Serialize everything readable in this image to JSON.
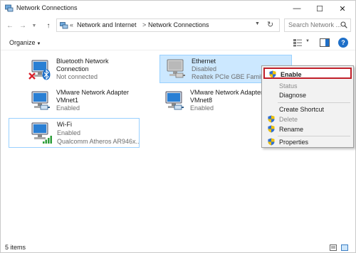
{
  "window": {
    "title": "Network Connections",
    "minimize_icon": "minimize-icon",
    "maximize_icon": "maximize-icon",
    "close_icon": "close-icon"
  },
  "address_bar": {
    "prefix": "«",
    "breadcrumbs": [
      "Network and Internet",
      "Network Connections"
    ],
    "separator": ">",
    "search_placeholder": "Search Network ..."
  },
  "command_bar": {
    "organize_label": "Organize"
  },
  "items": [
    {
      "name": "Bluetooth Network Connection",
      "name_line1": "Bluetooth Network",
      "name_line2": "Connection",
      "status": "Not connected",
      "device": "",
      "state": "disconnected"
    },
    {
      "name": "Ethernet",
      "status": "Disabled",
      "device": "Realtek PCIe GBE Family C...",
      "state": "disabled"
    },
    {
      "name_line1": "VMware Network Adapter",
      "name_line2": "VMnet1",
      "status": "Enabled",
      "device": "",
      "state": "enabled"
    },
    {
      "name_line1": "VMware Network Adapter",
      "name_line2": "VMnet8",
      "status": "Enabled",
      "device": "",
      "state": "enabled"
    },
    {
      "name": "Wi-Fi",
      "status": "Enabled",
      "device": "Qualcomm Atheros AR946x...",
      "state": "wifi"
    }
  ],
  "context_menu": {
    "items": [
      {
        "label": "Enable",
        "shield": true,
        "disabled": false,
        "default": true
      },
      {
        "label": "Status",
        "shield": false,
        "disabled": true
      },
      {
        "label": "Diagnose",
        "shield": false,
        "disabled": false
      },
      {
        "label": "Create Shortcut",
        "shield": false,
        "disabled": false
      },
      {
        "label": "Delete",
        "shield": true,
        "disabled": true
      },
      {
        "label": "Rename",
        "shield": true,
        "disabled": false
      },
      {
        "label": "Properties",
        "shield": true,
        "disabled": false
      }
    ]
  },
  "status_bar": {
    "item_count": "5 items"
  },
  "colors": {
    "selection_bg": "#cce8ff",
    "selection_border": "#99d1ff",
    "highlight_border": "#c0202a",
    "help_blue": "#1e6fc8"
  }
}
